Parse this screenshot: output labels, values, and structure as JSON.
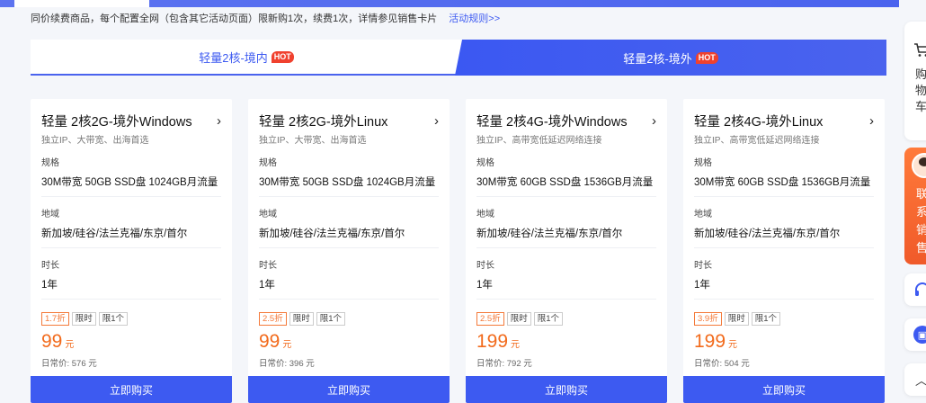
{
  "notice": {
    "text": "同价续费商品，每个配置全网（包含其它活动页面）限新购1次，续费1次，详情参见销售卡片",
    "link": "活动规则>>"
  },
  "tabs": [
    {
      "label": "轻量2核-境内",
      "hot": "HOT",
      "active": false
    },
    {
      "label": "轻量2核-境外",
      "hot": "HOT",
      "active": true
    }
  ],
  "labels": {
    "spec": "规格",
    "region": "地域",
    "duration": "时长",
    "limited_time": "限时",
    "limit_one": "限1个",
    "currency_unit": "元",
    "buy": "立即购买"
  },
  "cards": [
    {
      "title": "轻量 2核2G-境外Windows",
      "subtitle": "独立IP、大带宽、出海首选",
      "spec": "30M带宽 50GB SSD盘 1024GB月流量",
      "region": "新加坡/硅谷/法兰克福/东京/首尔",
      "duration": "1年",
      "discount": "1.7折",
      "price": "99",
      "regular": "日常价: 576 元"
    },
    {
      "title": "轻量 2核2G-境外Linux",
      "subtitle": "独立IP、大带宽、出海首选",
      "spec": "30M带宽 50GB SSD盘 1024GB月流量",
      "region": "新加坡/硅谷/法兰克福/东京/首尔",
      "duration": "1年",
      "discount": "2.5折",
      "price": "99",
      "regular": "日常价: 396 元"
    },
    {
      "title": "轻量 2核4G-境外Windows",
      "subtitle": "独立IP、高带宽低延迟网络连接",
      "spec": "30M带宽 60GB SSD盘 1536GB月流量",
      "region": "新加坡/硅谷/法兰克福/东京/首尔",
      "duration": "1年",
      "discount": "2.5折",
      "price": "199",
      "regular": "日常价: 792 元"
    },
    {
      "title": "轻量 2核4G-境外Linux",
      "subtitle": "独立IP、高带宽低延迟网络连接",
      "spec": "30M带宽 60GB SSD盘 1536GB月流量",
      "region": "新加坡/硅谷/法兰克福/东京/首尔",
      "duration": "1年",
      "discount": "3.9折",
      "price": "199",
      "regular": "日常价: 504 元"
    }
  ],
  "sidebar": {
    "cart_text": "购物车",
    "contact_text": "联系销售"
  },
  "colors": {
    "accent": "#3d5af1",
    "price": "#f26a1b",
    "hot": "#f0412e"
  }
}
